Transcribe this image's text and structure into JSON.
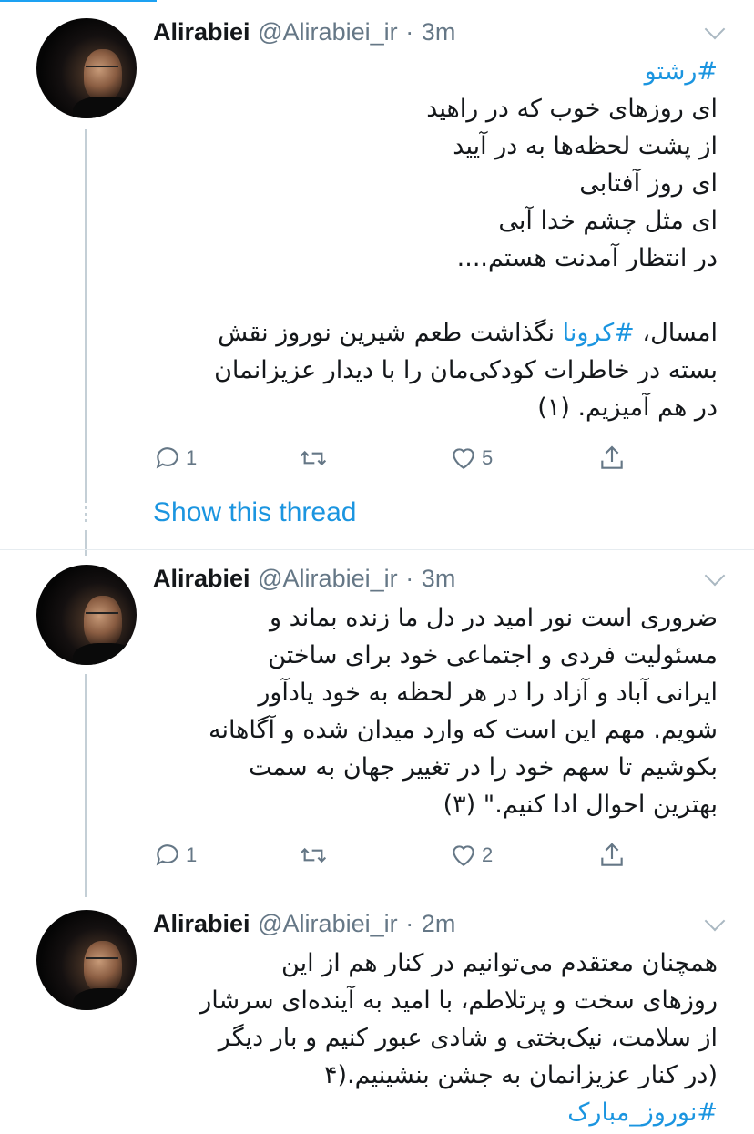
{
  "tweets": [
    {
      "name": "Alirabiei",
      "handle": "@Alirabiei_ir",
      "dot": "·",
      "time": "3m",
      "lines": [
        "#رشتو",
        "ای روزهای خوب که در راهید",
        "از پشت لحظه‌ها به در آیید",
        "ای روز آفتابی",
        "ای مثل چشم خدا آبی",
        "در انتظار آمدنت هستم....",
        "",
        "امسال، #کرونا نگذاشت طعم شیرین نوروز نقش",
        "بسته در خاطرات کودکی‌مان را با دیدار عزیزانمان",
        "در هم آمیزیم. (۱)"
      ],
      "replies": "1",
      "retweets": "",
      "likes": "5"
    },
    {
      "name": "Alirabiei",
      "handle": "@Alirabiei_ir",
      "dot": "·",
      "time": "3m",
      "lines": [
        "ضروری است نور امید در دل ما زنده بماند و",
        "مسئولیت فردی و اجتماعی خود برای ساختن",
        "ایرانی آباد و آزاد را در هر لحظه به خود یادآور",
        "شویم. مهم این است که وارد میدان شده و آگاهانه",
        "بکوشیم تا سهم خود را در تغییر جهان به سمت",
        "بهترین احوال ادا کنیم.\" (۳)"
      ],
      "replies": "1",
      "retweets": "",
      "likes": "2"
    },
    {
      "name": "Alirabiei",
      "handle": "@Alirabiei_ir",
      "dot": "·",
      "time": "2m",
      "lines": [
        "همچنان معتقدم می‌توانیم در کنار هم از این",
        "روزهای سخت و پرتلاطم، با امید به آینده‌ای سرشار",
        "از سلامت، نیک‌بختی و شادی عبور کنیم و بار دیگر",
        "(در کنار عزیزانمان به جشن بنشینیم.(۴",
        "#نوروز_مبارک"
      ]
    }
  ],
  "show_thread": "Show this thread",
  "icons": {
    "reply": "reply-icon",
    "retweet": "retweet-icon",
    "like": "heart-icon",
    "share": "share-icon",
    "menu": "chevron-down-icon"
  },
  "colors": {
    "link": "#1b95e0",
    "muted": "#657786",
    "thread": "#c4cfd6"
  }
}
